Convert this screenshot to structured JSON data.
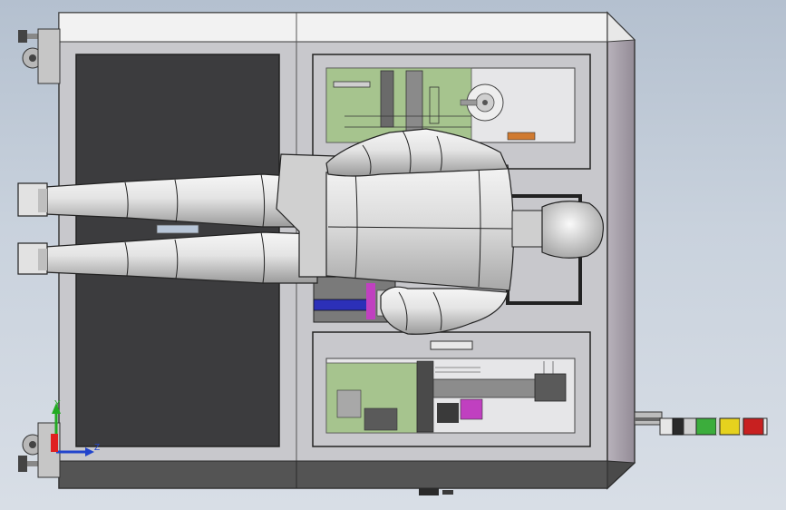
{
  "viewport": {
    "background_top": "#b4c0cf",
    "background_bottom": "#d8dee6",
    "model_colors": {
      "frame": "#c8c8cc",
      "frame_side": "#a29aa6",
      "top_plate": "#f2f2f2",
      "dark_panel": "#3c3c3e",
      "base_strip": "#545454",
      "window_bg": "#e6e6e8",
      "pcb_green": "#a6c48e",
      "mannequin": "#dcdcdc",
      "blue_part": "#2c30b8",
      "magenta_part": "#c040c0"
    },
    "triad_axes": {
      "y": "Y",
      "z": "Z"
    },
    "tower_light_colors": [
      "#2a2a2a",
      "#3cad3c",
      "#e6d21e",
      "#c82020"
    ],
    "icons": [
      "caster-wheel-icon",
      "leveling-foot-icon",
      "triad-axis-icon",
      "tower-light-icon"
    ]
  }
}
